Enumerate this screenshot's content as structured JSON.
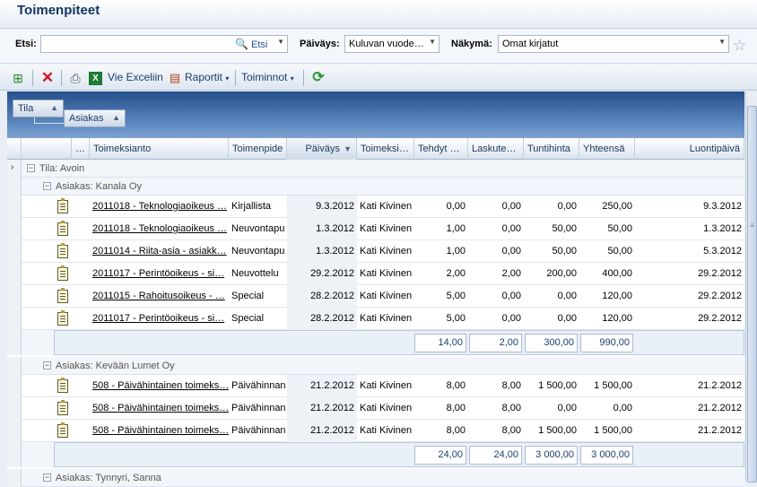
{
  "window": {
    "title": "Toimenpiteet"
  },
  "search": {
    "label": "Etsi:",
    "value": "",
    "button_label": "Etsi",
    "date_label": "Päiväys:",
    "date_value": "Kuluvan vuode…",
    "view_label": "Näkymä:",
    "view_value": "Omat kirjatut"
  },
  "toolbar": {
    "export_label": "Vie Exceliin",
    "reports_label": "Raportit",
    "actions_label": "Toiminnot"
  },
  "grouping": {
    "chips": [
      "Tila",
      "Asiakas"
    ]
  },
  "columns": [
    "…",
    "Toimeksianto",
    "Toimenpide",
    "Päiväys",
    "Toimeksi…",
    "Tehdyt …",
    "Laskute…",
    "Tuntihinta",
    "Yhteensä",
    "Luontipäivä"
  ],
  "groups": {
    "status": "Tila: Avoin",
    "customer1": "Asiakas: Kanala Oy",
    "customer2": "Asiakas: Kevään Lumet Oy",
    "customer3": "Asiakas: Tynnyri, Sanna"
  },
  "rows": [
    [
      "2011018 - Teknologiaoikeus …",
      "Kirjallista",
      "9.3.2012",
      "Kati Kivinen",
      "0,00",
      "0,00",
      "0,00",
      "250,00",
      "9.3.2012"
    ],
    [
      "2011018 - Teknologiaoikeus …",
      "Neuvontapu",
      "1.3.2012",
      "Kati Kivinen",
      "1,00",
      "0,00",
      "50,00",
      "50,00",
      "1.3.2012"
    ],
    [
      "2011014 - Riita-asia - asiakk…",
      "Neuvontapu",
      "1.3.2012",
      "Kati Kivinen",
      "1,00",
      "0,00",
      "50,00",
      "50,00",
      "5.3.2012"
    ],
    [
      "2011017 - Perintöoikeus - si…",
      "Neuvottelu",
      "29.2.2012",
      "Kati Kivinen",
      "2,00",
      "2,00",
      "200,00",
      "400,00",
      "29.2.2012"
    ],
    [
      "2011015 - Rahoitusoikeus - …",
      "Special",
      "28.2.2012",
      "Kati Kivinen",
      "5,00",
      "0,00",
      "0,00",
      "120,00",
      "29.2.2012"
    ],
    [
      "2011017 - Perintöoikeus - si…",
      "Special",
      "28.2.2012",
      "Kati Kivinen",
      "5,00",
      "0,00",
      "0,00",
      "120,00",
      "29.2.2012"
    ],
    [
      "508 - Päivähintainen toimeks…",
      "Päivähinnan",
      "21.2.2012",
      "Kati Kivinen",
      "8,00",
      "8,00",
      "1 500,00",
      "1 500,00",
      "21.2.2012"
    ],
    [
      "508 - Päivähintainen toimeks…",
      "Päivähinnan",
      "21.2.2012",
      "Kati Kivinen",
      "8,00",
      "8,00",
      "0,00",
      "0,00",
      "21.2.2012"
    ],
    [
      "508 - Päivähintainen toimeks…",
      "Päivähinnan",
      "21.2.2012",
      "Kati Kivinen",
      "8,00",
      "8,00",
      "1 500,00",
      "1 500,00",
      "21.2.2012"
    ]
  ],
  "summaries": [
    [
      "14,00",
      "2,00",
      "300,00",
      "990,00"
    ],
    [
      "24,00",
      "24,00",
      "3 000,00",
      "3 000,00"
    ]
  ]
}
